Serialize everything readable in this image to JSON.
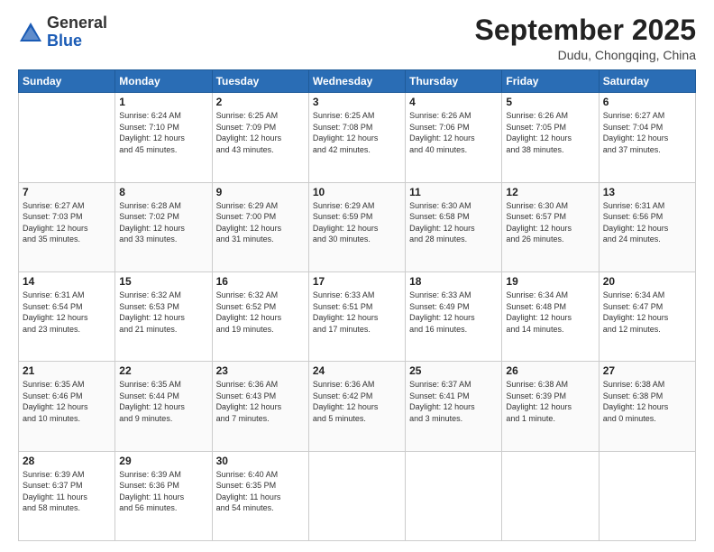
{
  "header": {
    "logo_general": "General",
    "logo_blue": "Blue",
    "month_title": "September 2025",
    "location": "Dudu, Chongqing, China"
  },
  "days_of_week": [
    "Sunday",
    "Monday",
    "Tuesday",
    "Wednesday",
    "Thursday",
    "Friday",
    "Saturday"
  ],
  "weeks": [
    [
      {
        "day": "",
        "info": ""
      },
      {
        "day": "1",
        "info": "Sunrise: 6:24 AM\nSunset: 7:10 PM\nDaylight: 12 hours\nand 45 minutes."
      },
      {
        "day": "2",
        "info": "Sunrise: 6:25 AM\nSunset: 7:09 PM\nDaylight: 12 hours\nand 43 minutes."
      },
      {
        "day": "3",
        "info": "Sunrise: 6:25 AM\nSunset: 7:08 PM\nDaylight: 12 hours\nand 42 minutes."
      },
      {
        "day": "4",
        "info": "Sunrise: 6:26 AM\nSunset: 7:06 PM\nDaylight: 12 hours\nand 40 minutes."
      },
      {
        "day": "5",
        "info": "Sunrise: 6:26 AM\nSunset: 7:05 PM\nDaylight: 12 hours\nand 38 minutes."
      },
      {
        "day": "6",
        "info": "Sunrise: 6:27 AM\nSunset: 7:04 PM\nDaylight: 12 hours\nand 37 minutes."
      }
    ],
    [
      {
        "day": "7",
        "info": "Sunrise: 6:27 AM\nSunset: 7:03 PM\nDaylight: 12 hours\nand 35 minutes."
      },
      {
        "day": "8",
        "info": "Sunrise: 6:28 AM\nSunset: 7:02 PM\nDaylight: 12 hours\nand 33 minutes."
      },
      {
        "day": "9",
        "info": "Sunrise: 6:29 AM\nSunset: 7:00 PM\nDaylight: 12 hours\nand 31 minutes."
      },
      {
        "day": "10",
        "info": "Sunrise: 6:29 AM\nSunset: 6:59 PM\nDaylight: 12 hours\nand 30 minutes."
      },
      {
        "day": "11",
        "info": "Sunrise: 6:30 AM\nSunset: 6:58 PM\nDaylight: 12 hours\nand 28 minutes."
      },
      {
        "day": "12",
        "info": "Sunrise: 6:30 AM\nSunset: 6:57 PM\nDaylight: 12 hours\nand 26 minutes."
      },
      {
        "day": "13",
        "info": "Sunrise: 6:31 AM\nSunset: 6:56 PM\nDaylight: 12 hours\nand 24 minutes."
      }
    ],
    [
      {
        "day": "14",
        "info": "Sunrise: 6:31 AM\nSunset: 6:54 PM\nDaylight: 12 hours\nand 23 minutes."
      },
      {
        "day": "15",
        "info": "Sunrise: 6:32 AM\nSunset: 6:53 PM\nDaylight: 12 hours\nand 21 minutes."
      },
      {
        "day": "16",
        "info": "Sunrise: 6:32 AM\nSunset: 6:52 PM\nDaylight: 12 hours\nand 19 minutes."
      },
      {
        "day": "17",
        "info": "Sunrise: 6:33 AM\nSunset: 6:51 PM\nDaylight: 12 hours\nand 17 minutes."
      },
      {
        "day": "18",
        "info": "Sunrise: 6:33 AM\nSunset: 6:49 PM\nDaylight: 12 hours\nand 16 minutes."
      },
      {
        "day": "19",
        "info": "Sunrise: 6:34 AM\nSunset: 6:48 PM\nDaylight: 12 hours\nand 14 minutes."
      },
      {
        "day": "20",
        "info": "Sunrise: 6:34 AM\nSunset: 6:47 PM\nDaylight: 12 hours\nand 12 minutes."
      }
    ],
    [
      {
        "day": "21",
        "info": "Sunrise: 6:35 AM\nSunset: 6:46 PM\nDaylight: 12 hours\nand 10 minutes."
      },
      {
        "day": "22",
        "info": "Sunrise: 6:35 AM\nSunset: 6:44 PM\nDaylight: 12 hours\nand 9 minutes."
      },
      {
        "day": "23",
        "info": "Sunrise: 6:36 AM\nSunset: 6:43 PM\nDaylight: 12 hours\nand 7 minutes."
      },
      {
        "day": "24",
        "info": "Sunrise: 6:36 AM\nSunset: 6:42 PM\nDaylight: 12 hours\nand 5 minutes."
      },
      {
        "day": "25",
        "info": "Sunrise: 6:37 AM\nSunset: 6:41 PM\nDaylight: 12 hours\nand 3 minutes."
      },
      {
        "day": "26",
        "info": "Sunrise: 6:38 AM\nSunset: 6:39 PM\nDaylight: 12 hours\nand 1 minute."
      },
      {
        "day": "27",
        "info": "Sunrise: 6:38 AM\nSunset: 6:38 PM\nDaylight: 12 hours\nand 0 minutes."
      }
    ],
    [
      {
        "day": "28",
        "info": "Sunrise: 6:39 AM\nSunset: 6:37 PM\nDaylight: 11 hours\nand 58 minutes."
      },
      {
        "day": "29",
        "info": "Sunrise: 6:39 AM\nSunset: 6:36 PM\nDaylight: 11 hours\nand 56 minutes."
      },
      {
        "day": "30",
        "info": "Sunrise: 6:40 AM\nSunset: 6:35 PM\nDaylight: 11 hours\nand 54 minutes."
      },
      {
        "day": "",
        "info": ""
      },
      {
        "day": "",
        "info": ""
      },
      {
        "day": "",
        "info": ""
      },
      {
        "day": "",
        "info": ""
      }
    ]
  ]
}
